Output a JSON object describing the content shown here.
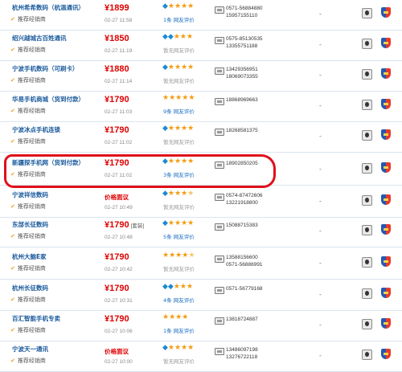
{
  "listings": [
    {
      "shop": "杭州希希数码（杭温通讯）",
      "badge": "推荐经销商",
      "price": "¥1899",
      "price_suffix": "",
      "time": "02-27 11:58",
      "rating": "◆★★★★",
      "review": "1条 网友评价",
      "review_gray": false,
      "phones": [
        "0571-56884880",
        "15957155110"
      ],
      "dash": "-"
    },
    {
      "shop": "绍兴越城古百姓通讯",
      "badge": "推荐经销商",
      "price": "¥1850",
      "price_suffix": "",
      "time": "02-27 11:19",
      "rating": "◆◆★★★",
      "review": "暂无网友评价",
      "review_gray": true,
      "phones": [
        "0575-85130535",
        "13355751188"
      ],
      "dash": "-"
    },
    {
      "shop": "宁波手机数码（可刷卡）",
      "badge": "推荐经销商",
      "price": "¥1880",
      "price_suffix": "",
      "time": "02-27 11:14",
      "rating": "◆★★★★",
      "review": "暂无网友评价",
      "review_gray": true,
      "phones": [
        "13429356951",
        "18069073355"
      ],
      "dash": "-"
    },
    {
      "shop": "华易手机商城（货到付款）",
      "badge": "推荐经销商",
      "price": "¥1790",
      "price_suffix": "",
      "time": "02-27 11:03",
      "rating": "★★★★★",
      "review": "9条 网友评价",
      "review_gray": false,
      "phones": [
        "18868969663"
      ],
      "dash": "-"
    },
    {
      "shop": "宁波冰点手机连锁",
      "badge": "推荐经销商",
      "price": "¥1790",
      "price_suffix": "",
      "time": "02-27 11:02",
      "rating": "◆★★★★",
      "review": "暂无网友评价",
      "review_gray": true,
      "phones": [
        "18268581375"
      ],
      "dash": "-"
    },
    {
      "shop": "新疆探手机网（货到付款）",
      "badge": "推荐经销商",
      "price": "¥1790",
      "price_suffix": "",
      "time": "02-27 11:02",
      "rating": "◆★★★★",
      "review": "3条 网友评价",
      "review_gray": false,
      "phones": [
        "18902850205"
      ],
      "dash": "-"
    },
    {
      "shop": "宁波祥信数码",
      "badge": "推荐经销商",
      "price": "价格面议",
      "price_suffix": "",
      "time": "02-27 10:49",
      "rating": "◆★★★☆",
      "review": "暂无网友评价",
      "review_gray": true,
      "phones": [
        "0574-87472606",
        "13221918800"
      ],
      "dash": "-"
    },
    {
      "shop": "东部长征数码",
      "badge": "推荐经销商",
      "price": "¥1790",
      "price_suffix": "[套装]",
      "time": "02-27 10:48",
      "rating": "◆★★★★",
      "review": "5条 网友评价",
      "review_gray": false,
      "phones": [
        "15088715383"
      ],
      "dash": "-"
    },
    {
      "shop": "杭州大脑E家",
      "badge": "推荐经销商",
      "price": "¥1790",
      "price_suffix": "",
      "time": "02-27 10:42",
      "rating": "★★★★☆",
      "review": "暂无网友评价",
      "review_gray": true,
      "phones": [
        "13588156600",
        "0571-56886991"
      ],
      "dash": "-"
    },
    {
      "shop": "杭州长征数码",
      "badge": "推荐经销商",
      "price": "¥1790",
      "price_suffix": "",
      "time": "02-27 10:31",
      "rating": "◆◆★★★",
      "review": "4条 网友评价",
      "review_gray": false,
      "phones": [
        "0571-56779168"
      ],
      "dash": "-"
    },
    {
      "shop": "百汇智能手机专卖",
      "badge": "推荐经销商",
      "price": "¥1790",
      "price_suffix": "",
      "time": "02-27 10:06",
      "rating": "★★★★",
      "review": "1条 网友评价",
      "review_gray": false,
      "phones": [
        "13818724887"
      ],
      "dash": "-"
    },
    {
      "shop": "宁波天一通讯",
      "badge": "推荐经销商",
      "price": "价格面议",
      "price_suffix": "",
      "time": "02-27 10:00",
      "rating": "◆★★★★",
      "review": "暂无网友评价",
      "review_gray": true,
      "phones": [
        "13486097198",
        "13276722118"
      ],
      "dash": "-"
    }
  ],
  "colors": {
    "accent_red": "#d00000",
    "link_blue": "#1a5a9c",
    "star": "#f39c12",
    "diamond": "#1a8ad4",
    "highlight": "#e0101a"
  },
  "icons": {
    "phone": "phone-icon",
    "qq": "qq-chat-icon",
    "shield": "trusted-shield-icon",
    "check": "check-icon"
  }
}
